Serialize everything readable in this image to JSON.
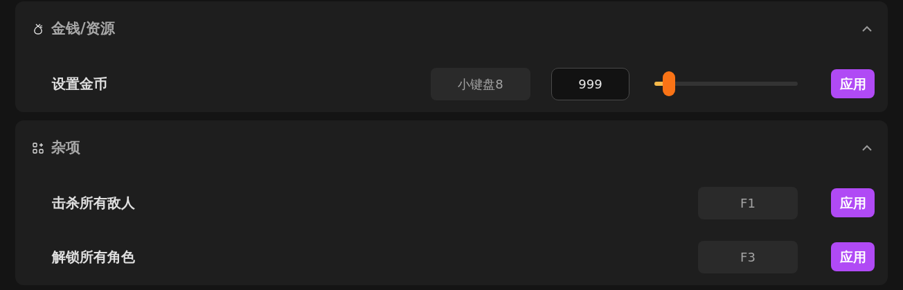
{
  "sections": [
    {
      "title": "金钱/资源",
      "expanded": true,
      "rows": [
        {
          "kind": "slider",
          "label": "设置金币",
          "hotkey": "小键盘8",
          "value": "999",
          "level": 0.1,
          "button": "应用"
        }
      ]
    },
    {
      "title": "杂项",
      "expanded": true,
      "rows": [
        {
          "kind": "hotkey",
          "label": "击杀所有敌人",
          "hotkey": "F1",
          "button": "应用"
        },
        {
          "kind": "hotkey",
          "label": "解锁所有角色",
          "hotkey": "F3",
          "button": "应用"
        }
      ]
    }
  ]
}
